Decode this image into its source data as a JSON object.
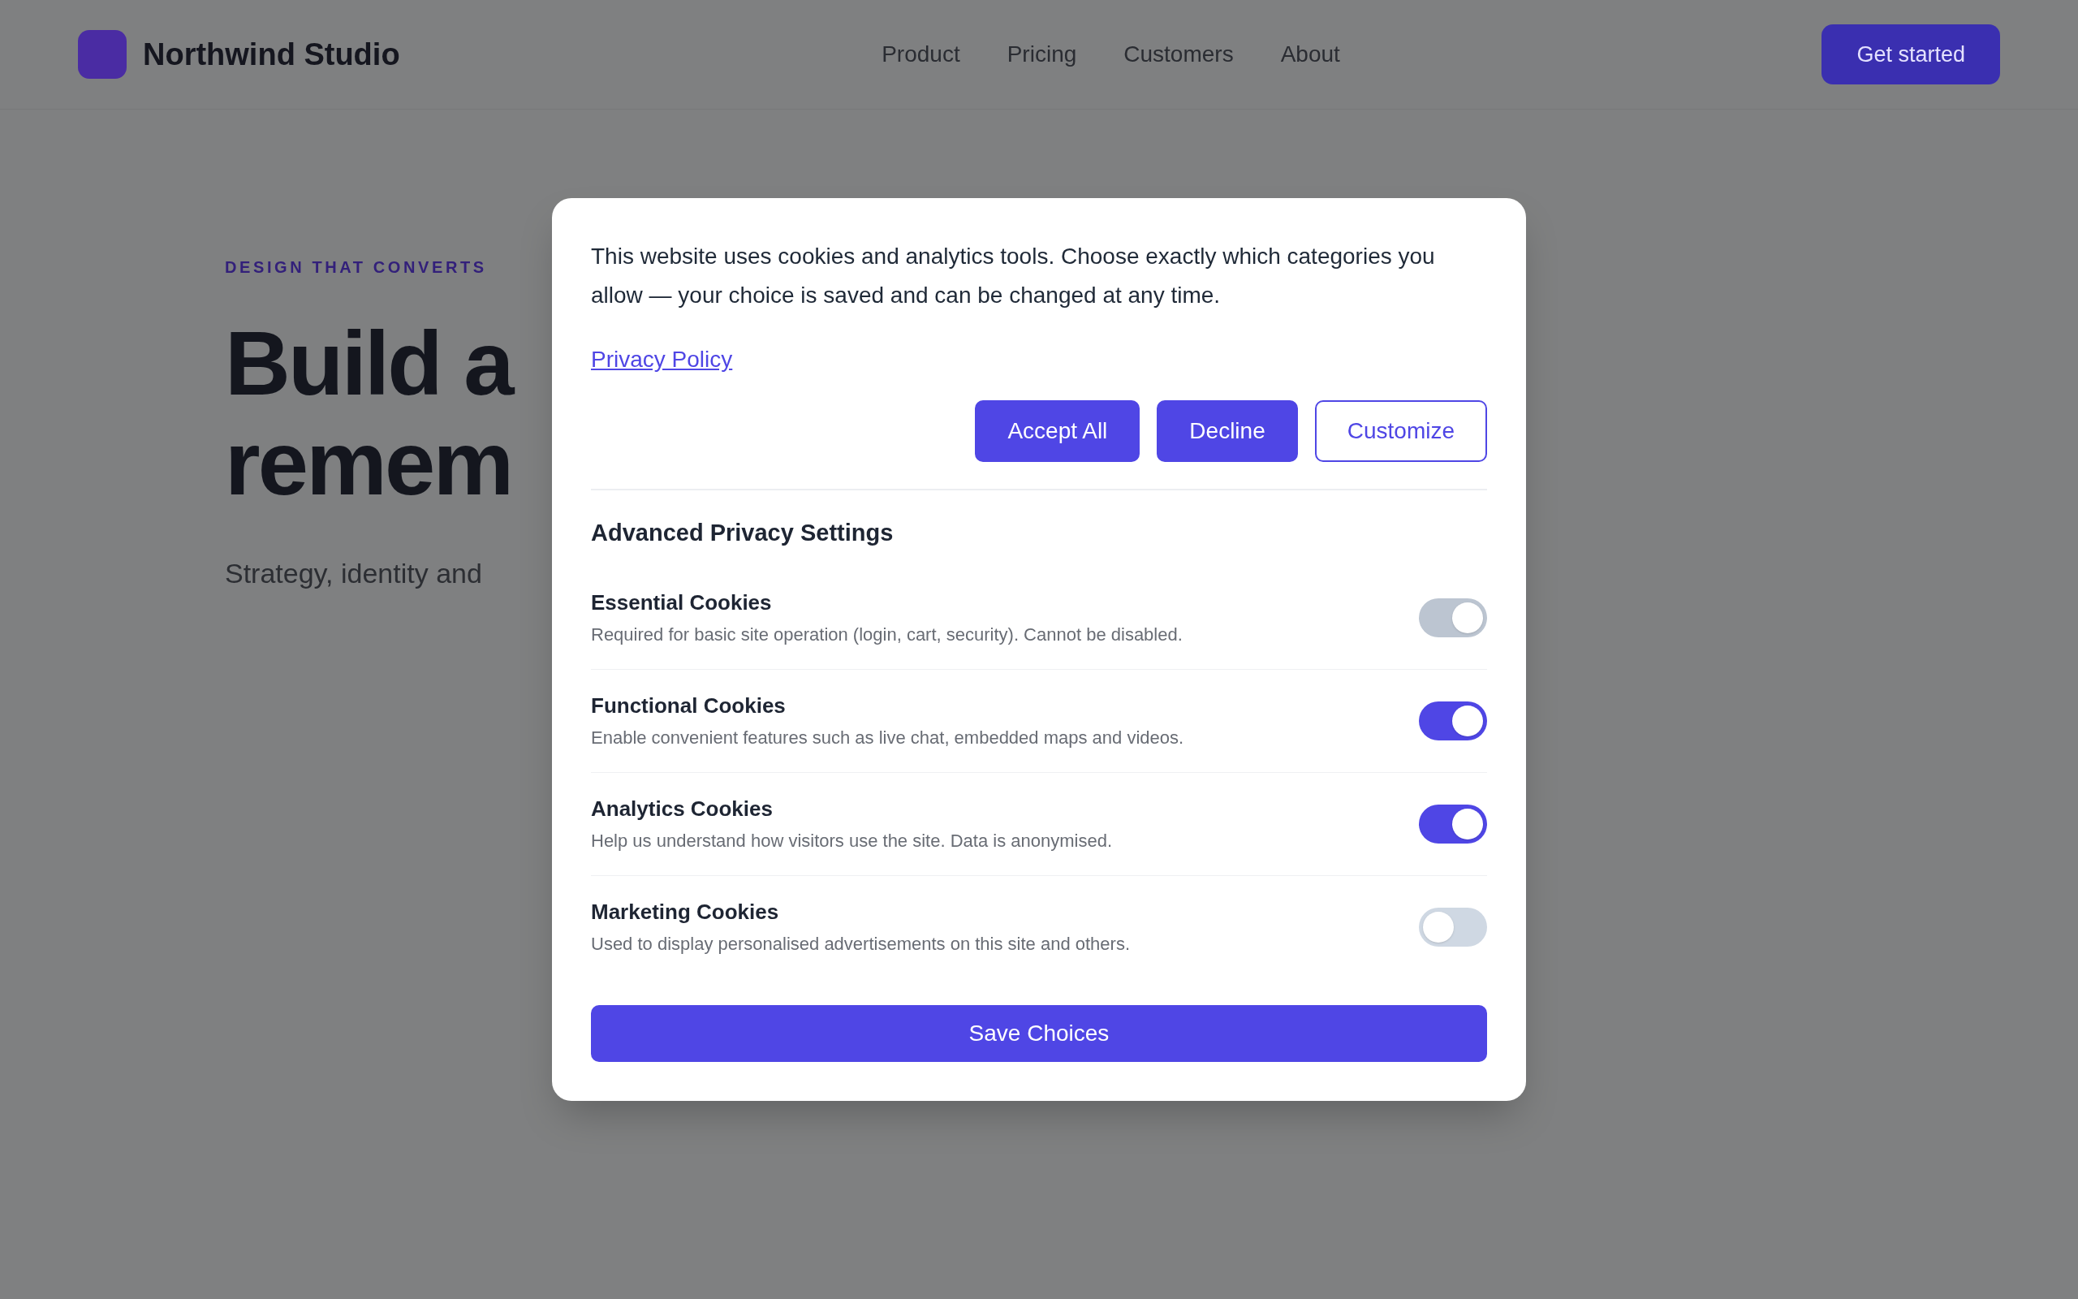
{
  "background_page": {
    "header": {
      "brand": "Northwind Studio",
      "nav_links": [
        "Product",
        "Pricing",
        "Customers",
        "About"
      ],
      "cta": "Get started"
    },
    "hero": {
      "eyebrow": "DESIGN THAT CONVERTS",
      "heading_lines": [
        "Build a",
        "remem"
      ],
      "subtitle": "Strategy, identity and"
    }
  },
  "cookie_dialog": {
    "message": "This website uses cookies and analytics tools. Choose exactly which categories you allow — your choice is saved and can be changed at any time.",
    "privacy_link": "Privacy Policy",
    "buttons": [
      {
        "label": "Accept All",
        "kind": "filled"
      },
      {
        "label": "Decline",
        "kind": "filled"
      },
      {
        "label": "Customize",
        "kind": "outlined"
      }
    ],
    "settings_title": "Advanced Privacy Settings",
    "categories": [
      {
        "title": "Essential Cookies",
        "description": "Required for basic site operation (login, cart, security). Cannot be disabled.",
        "on": true,
        "disabled": true
      },
      {
        "title": "Functional Cookies",
        "description": "Enable convenient features such as live chat, embedded maps and videos.",
        "on": true,
        "disabled": false
      },
      {
        "title": "Analytics Cookies",
        "description": "Help us understand how visitors use the site. Data is anonymised.",
        "on": true,
        "disabled": false
      },
      {
        "title": "Marketing Cookies",
        "description": "Used to display personalised advertisements on this site and others.",
        "on": false,
        "disabled": false
      }
    ],
    "save_button": "Save Choices"
  }
}
